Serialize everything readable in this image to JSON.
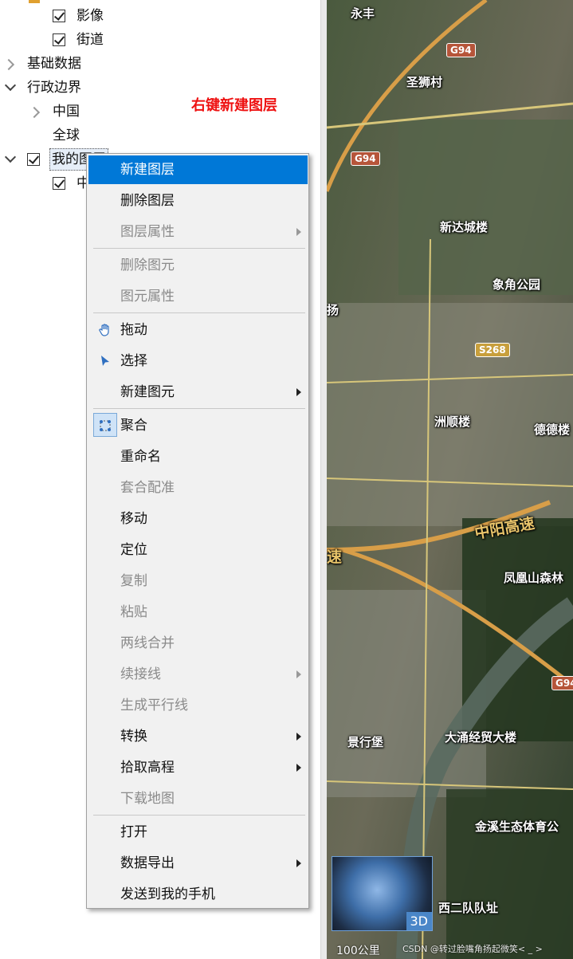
{
  "tree": {
    "items": [
      {
        "label": "影像",
        "checked": true
      },
      {
        "label": "街道",
        "checked": true
      },
      {
        "label": "基础数据",
        "expand": "collapsed"
      },
      {
        "label": "行政边界",
        "expand": "expanded"
      },
      {
        "label": "中国",
        "expand": "collapsed"
      },
      {
        "label": "全球"
      },
      {
        "label": "我的图层",
        "checked": true,
        "expand": "expanded"
      },
      {
        "label": "中",
        "checked": true
      }
    ]
  },
  "annotation": "右键新建图层",
  "context_menu": {
    "items": [
      {
        "label": "新建图层",
        "highlighted": true
      },
      {
        "label": "删除图层"
      },
      {
        "label": "图层属性",
        "disabled": true,
        "submenu": true
      },
      {
        "label": "删除图元",
        "disabled": true
      },
      {
        "label": "图元属性",
        "disabled": true
      },
      {
        "label": "拖动",
        "icon": "hand-icon"
      },
      {
        "label": "选择",
        "icon": "pointer-arrow-icon"
      },
      {
        "label": "新建图元",
        "submenu": true
      },
      {
        "label": "聚合",
        "icon": "aggregate-icon",
        "checked": true
      },
      {
        "label": "重命名"
      },
      {
        "label": "套合配准",
        "disabled": true
      },
      {
        "label": "移动"
      },
      {
        "label": "定位"
      },
      {
        "label": "复制",
        "disabled": true
      },
      {
        "label": "粘贴",
        "disabled": true
      },
      {
        "label": "两线合并",
        "disabled": true
      },
      {
        "label": "续接线",
        "disabled": true,
        "submenu": true
      },
      {
        "label": "生成平行线",
        "disabled": true
      },
      {
        "label": "转换",
        "submenu": true
      },
      {
        "label": "拾取高程",
        "submenu": true
      },
      {
        "label": "下载地图",
        "disabled": true
      },
      {
        "label": "打开"
      },
      {
        "label": "数据导出",
        "submenu": true
      },
      {
        "label": "发送到我的手机"
      }
    ],
    "highlight_color": "#0078d7"
  },
  "map": {
    "labels": [
      "永丰",
      "圣狮村",
      "新达城楼",
      "象角公园",
      "扬",
      "洲顺楼",
      "德德楼",
      "中阳高速",
      "速",
      "凤凰山森林",
      "景行堡",
      "大涌经贸大楼",
      "金溪生态体育公",
      "西二队队址"
    ],
    "shields": [
      "G94",
      "G94",
      "S268",
      "G94"
    ],
    "minimap_badge": "3D",
    "scale": "100公里",
    "watermark": "CSDN @转过脸嘴角扬起微笑< _ >"
  },
  "colors": {
    "annotation": "#e11111",
    "accent": "#0078d7"
  }
}
